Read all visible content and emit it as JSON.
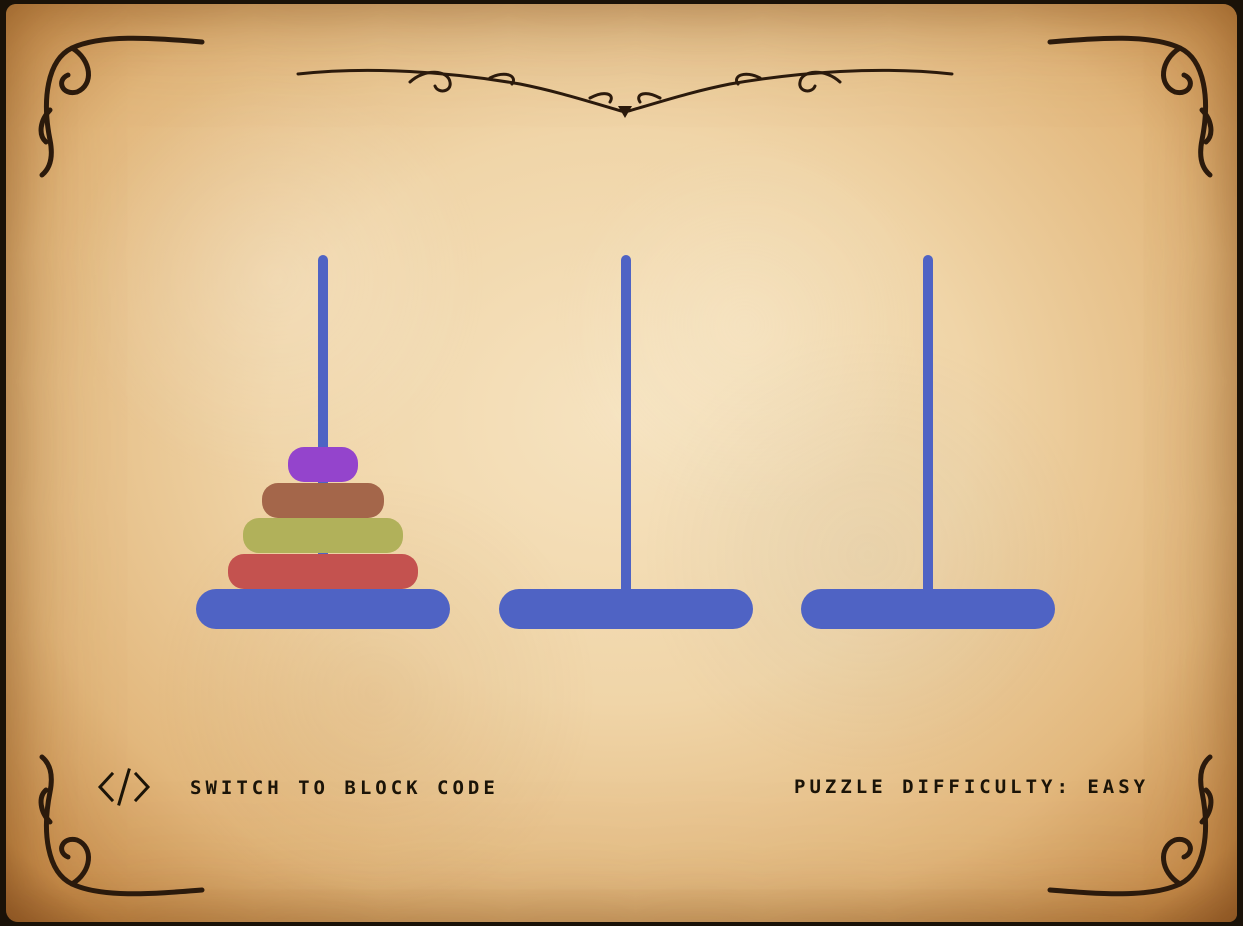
{
  "game": {
    "switch_label": "Switch to block code",
    "switch_icon": "code-icon",
    "difficulty_text": "Puzzle difficulty: easy",
    "peg_color": "#4f63c4"
  },
  "pegs": [
    {
      "name": "left",
      "disks": [
        {
          "size": 4,
          "color": "#c4524f"
        },
        {
          "size": 3,
          "color": "#b1b15a"
        },
        {
          "size": 2,
          "color": "#a4664a"
        },
        {
          "size": 1,
          "color": "#9444cc"
        }
      ]
    },
    {
      "name": "middle",
      "disks": []
    },
    {
      "name": "right",
      "disks": []
    }
  ]
}
